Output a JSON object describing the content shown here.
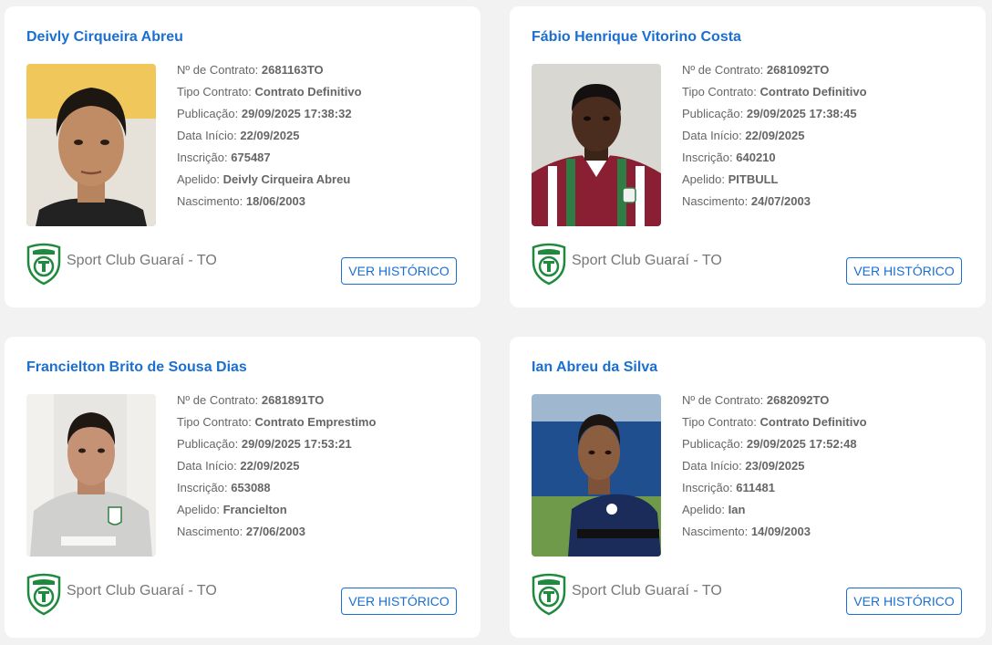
{
  "labels": {
    "contract_no": "Nº de Contrato:",
    "contract_type": "Tipo Contrato:",
    "publication": "Publicação:",
    "start_date": "Data Início:",
    "registration": "Inscrição:",
    "nickname": "Apelido:",
    "birth": "Nascimento:",
    "history_button": "VER HISTÓRICO"
  },
  "players": [
    {
      "name": "Deivly Cirqueira Abreu",
      "contract_no": "2681163TO",
      "contract_type": "Contrato Definitivo",
      "publication": "29/09/2025 17:38:32",
      "start_date": "22/09/2025",
      "registration": "675487",
      "nickname": "Deivly Cirqueira Abreu",
      "birth": "18/06/2003",
      "club": "Sport Club Guaraí - TO"
    },
    {
      "name": "Fábio Henrique Vitorino Costa",
      "contract_no": "2681092TO",
      "contract_type": "Contrato Definitivo",
      "publication": "29/09/2025 17:38:45",
      "start_date": "22/09/2025",
      "registration": "640210",
      "nickname": "PITBULL",
      "birth": "24/07/2003",
      "club": "Sport Club Guaraí - TO"
    },
    {
      "name": "Francielton Brito de Sousa Dias",
      "contract_no": "2681891TO",
      "contract_type": "Contrato Emprestimo",
      "publication": "29/09/2025 17:53:21",
      "start_date": "22/09/2025",
      "registration": "653088",
      "nickname": "Francielton",
      "birth": "27/06/2003",
      "club": "Sport Club Guaraí - TO"
    },
    {
      "name": "Ian Abreu da Silva",
      "contract_no": "2682092TO",
      "contract_type": "Contrato Definitivo",
      "publication": "29/09/2025 17:52:48",
      "start_date": "23/09/2025",
      "registration": "611481",
      "nickname": "Ian",
      "birth": "14/09/2003",
      "club": "Sport Club Guaraí - TO"
    }
  ],
  "colors": {
    "accent": "#1a6fd1",
    "text_muted": "#666666",
    "crest_green": "#1f8a3e"
  }
}
